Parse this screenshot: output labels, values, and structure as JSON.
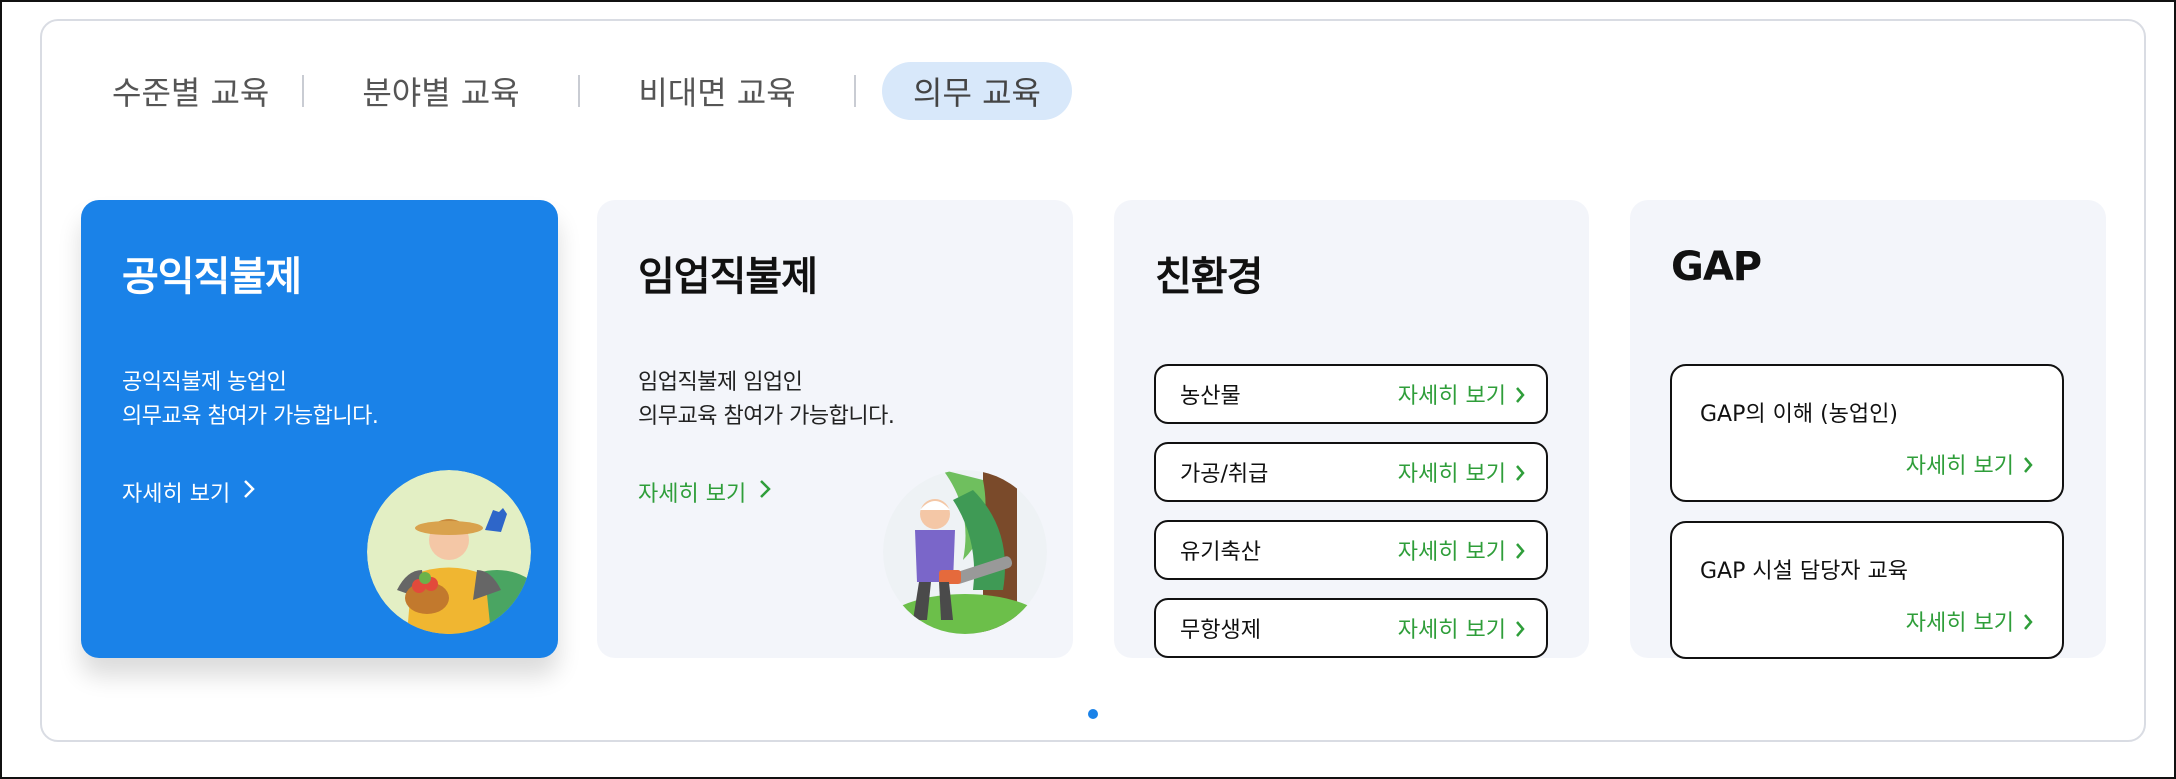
{
  "tabs": [
    {
      "label": "수준별 교육",
      "active": false
    },
    {
      "label": "분야별 교육",
      "active": false
    },
    {
      "label": "비대면 교육",
      "active": false
    },
    {
      "label": "의무 교육",
      "active": true
    }
  ],
  "cards": [
    {
      "title": "공익직불제",
      "desc_line1": "공익직불제 농업인",
      "desc_line2": "의무교육 참여가 가능합니다.",
      "more_label": "자세히 보기",
      "illustration": "farmer-illustration"
    },
    {
      "title": "임업직불제",
      "desc_line1": "임업직불제 임업인",
      "desc_line2": "의무교육 참여가 가능합니다.",
      "more_label": "자세히 보기",
      "illustration": "forester-illustration"
    },
    {
      "title": "친환경",
      "items": [
        {
          "label": "농산물",
          "more_label": "자세히 보기"
        },
        {
          "label": "가공/취급",
          "more_label": "자세히 보기"
        },
        {
          "label": "유기축산",
          "more_label": "자세히 보기"
        },
        {
          "label": "무항생제",
          "more_label": "자세히 보기"
        }
      ]
    },
    {
      "title": "GAP",
      "items": [
        {
          "label": "GAP의 이해 (농업인)",
          "more_label": "자세히 보기"
        },
        {
          "label": "GAP 시설 담당자 교육",
          "more_label": "자세히 보기"
        }
      ]
    }
  ],
  "pagination": {
    "pages": 1,
    "current": 1
  },
  "colors": {
    "accent_blue": "#1a82e8",
    "link_green": "#2f9e3a",
    "active_tab_bg": "#d8e8fa",
    "card_bg": "#f3f5fa"
  }
}
